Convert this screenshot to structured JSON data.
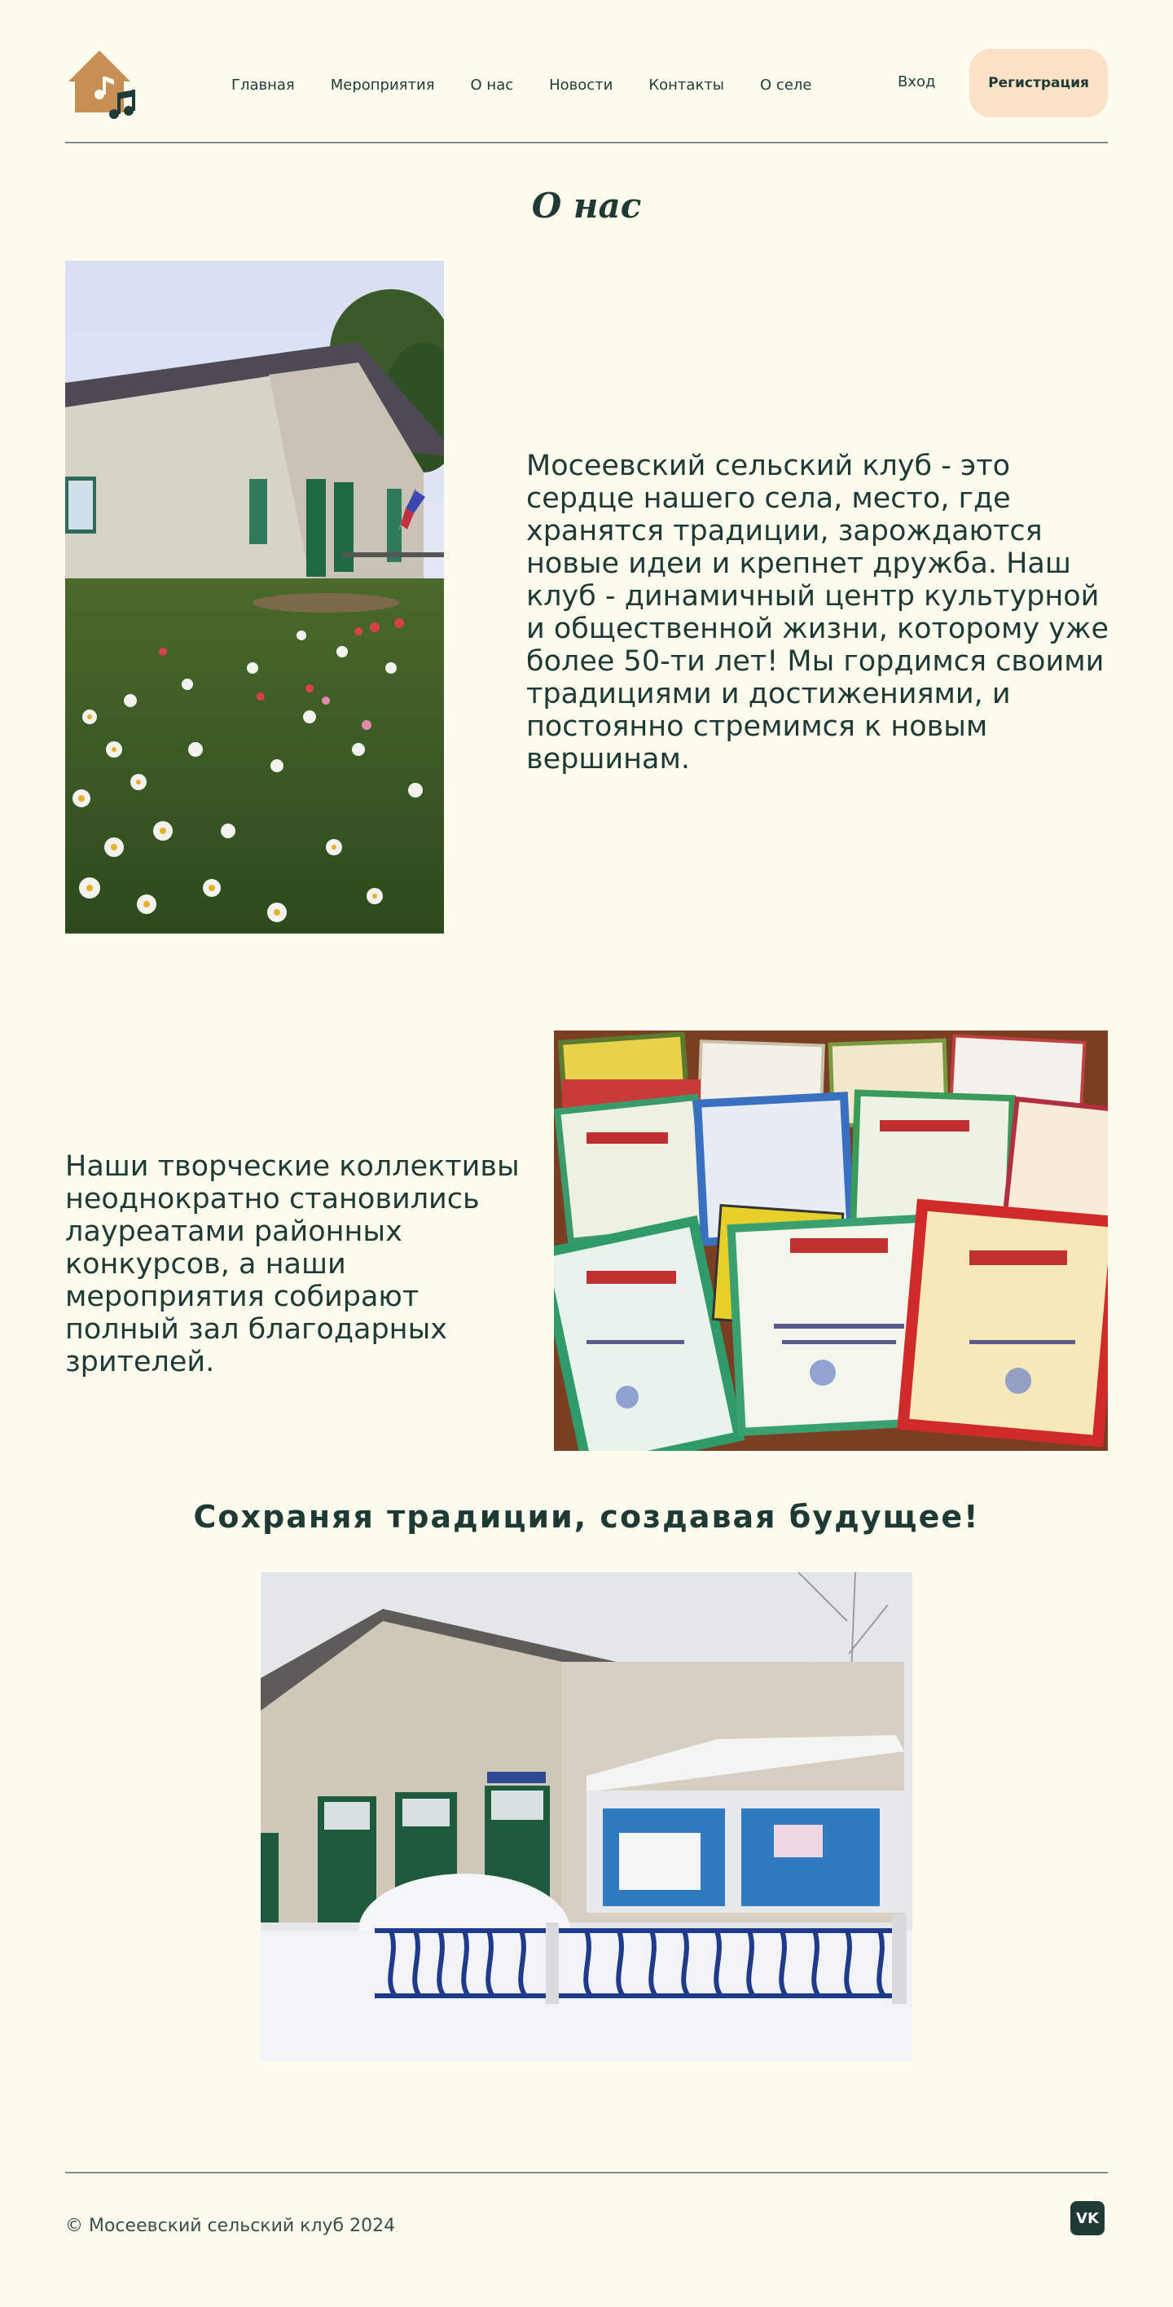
{
  "header": {
    "logo_icon": "house-music-note-icon",
    "nav": [
      {
        "label": "Главная"
      },
      {
        "label": "Мероприятия"
      },
      {
        "label": "О нас"
      },
      {
        "label": "Новости"
      },
      {
        "label": "Контакты"
      },
      {
        "label": "О селе"
      }
    ],
    "login_label": "Вход",
    "register_label": "Регистрация"
  },
  "about": {
    "title": "О нас",
    "paragraph1": "Мосеевский сельский клуб - это сердце нашего села, место, где хранятся традиции, зарождаются новые идеи и крепнет дружба. Наш клуб - динамичный центр культурной и общественной жизни, которому уже более 50-ти лет! Мы гордимся своими традициями и достижениями, и постоянно стремимся к новым вершинам.",
    "paragraph2": "Наши творческие коллективы неоднократно становились лауреатами районных конкурсов, а наши мероприятия собирают полный зал благодарных зрителей.",
    "slogan": "Сохраняя традиции, создавая будущее!"
  },
  "footer": {
    "copyright": "© Мосеевский сельский клуб 2024",
    "vk_icon": "vk-icon",
    "vk_label": "VK"
  },
  "colors": {
    "background": "#fdfcef",
    "text": "#1f3a34",
    "accent": "#fbe2c6",
    "logo": "#c88f55"
  }
}
